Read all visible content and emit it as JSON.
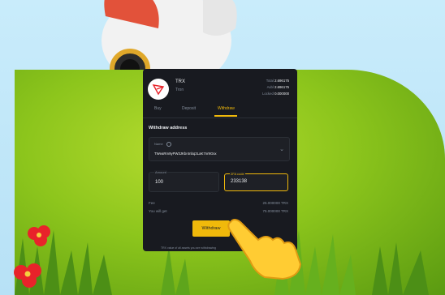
{
  "coin": {
    "symbol": "TRX",
    "name": "Tron"
  },
  "balances": [
    {
      "label": "Total",
      "value": "2.696175"
    },
    {
      "label": "Avbl",
      "value": "2.696175"
    },
    {
      "label": "Locked",
      "value": "0.000000"
    }
  ],
  "tabs": [
    {
      "label": "Buy",
      "active": false
    },
    {
      "label": "Deposit",
      "active": false
    },
    {
      "label": "Withdraw",
      "active": true
    }
  ],
  "withdraw": {
    "address_title": "Withdraw address",
    "address_label": "Name",
    "address_value": "TWeaRm9yPW3JKbr4nbq3LaK7nr9Gsx",
    "amount_label": "Amount",
    "amount_value": "100",
    "twofa_label": "2FA code",
    "twofa_value": "233138",
    "fee_label": "Fee",
    "fee_value": "25.000000 TRX",
    "get_label": "You will get",
    "get_value": "75.000000 TRX",
    "button_label": "Withdraw",
    "footnote": "TRX value of all assets you are withdrawing"
  },
  "colors": {
    "accent": "#f0b90b",
    "panel": "#181a20",
    "grass": "#8cc51c",
    "sky": "#c9ecfb"
  }
}
